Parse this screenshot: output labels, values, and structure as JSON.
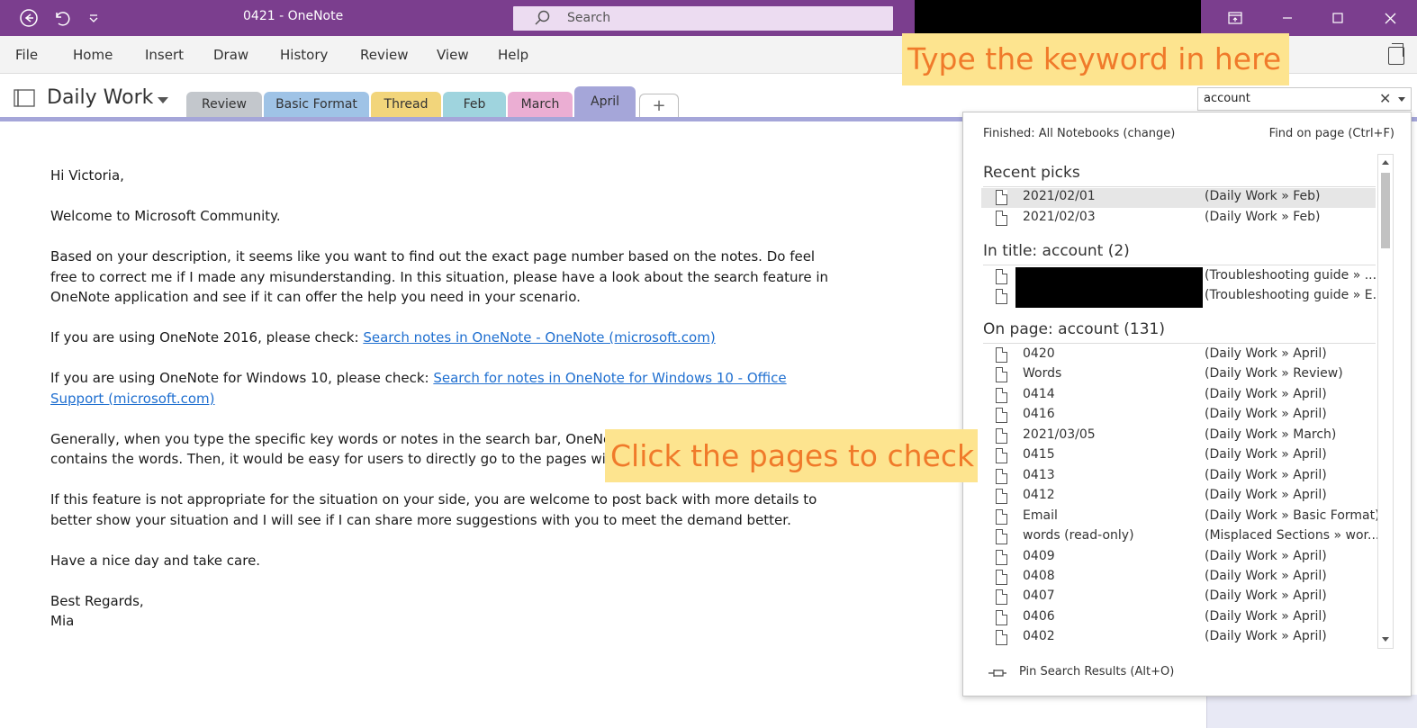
{
  "window": {
    "title": "0421  -  OneNote",
    "search_label": "Search"
  },
  "menu": [
    "File",
    "Home",
    "Insert",
    "Draw",
    "History",
    "Review",
    "View",
    "Help"
  ],
  "notebook": {
    "name": "Daily Work",
    "tabs": [
      {
        "label": "Review",
        "color": "#c3c7cc"
      },
      {
        "label": "Basic Format",
        "color": "#9fc3e6"
      },
      {
        "label": "Thread",
        "color": "#f2d57b"
      },
      {
        "label": "Feb",
        "color": "#9fd4de"
      },
      {
        "label": "March",
        "color": "#ebaed3"
      },
      {
        "label": "April",
        "color": "#a5a6d9",
        "active": true
      }
    ],
    "add_tab": "+"
  },
  "search": {
    "value": "account",
    "clear": "✕"
  },
  "page": {
    "greeting": "Hi Victoria,",
    "welcome": "Welcome to Microsoft Community.",
    "p1": "Based on your description, it seems like you want to find out the exact page number based on the notes. Do feel free to correct me if I made any misunderstanding. In this situation, please have a look about the search feature in OneNote application and see if it can offer the help you need in your scenario.",
    "p2_text": "If you are using OneNote 2016, please check: ",
    "p2_link": "Search notes in OneNote - OneNote (microsoft.com)",
    "p3_text": "If you are using OneNote for Windows 10, please check: ",
    "p3_link": "Search for notes in OneNote for Windows 10 - Office Support (microsoft.com)",
    "p4": "Generally, when you type the specific key words or notes in the search bar, OneNote will list the locations where contains the words. Then, it would be easy for users to directly go to the pages with the highlighted keywords.",
    "p5": "If this feature is not appropriate for the situation on your side, you are welcome to post back with more details to better show your situation and I will see if I can share more suggestions with you to meet the demand better.",
    "p6": "Have a nice day and take care.",
    "sign1": "Best Regards,",
    "sign2": "Mia"
  },
  "results": {
    "status": "Finished:  All Notebooks (change)",
    "find_on_page": "Find on page (Ctrl+F)",
    "recent_heading": "Recent picks",
    "recent": [
      {
        "name": "2021/02/01",
        "loc": "(Daily Work » Feb)"
      },
      {
        "name": "2021/02/03",
        "loc": "(Daily Work » Feb)"
      }
    ],
    "title_heading": "In title:  account (2)",
    "in_title": [
      {
        "name": "",
        "loc": "(Troubleshooting guide » ..."
      },
      {
        "name": "",
        "loc": "(Troubleshooting guide » E..."
      }
    ],
    "page_heading": "On page:  account (131)",
    "on_page": [
      {
        "name": "0420",
        "loc": "(Daily Work » April)"
      },
      {
        "name": "Words",
        "loc": "(Daily Work » Review)"
      },
      {
        "name": "0414",
        "loc": "(Daily Work » April)"
      },
      {
        "name": "0416",
        "loc": "(Daily Work » April)"
      },
      {
        "name": "2021/03/05",
        "loc": "(Daily Work » March)"
      },
      {
        "name": "0415",
        "loc": "(Daily Work » April)"
      },
      {
        "name": "0413",
        "loc": "(Daily Work » April)"
      },
      {
        "name": "0412",
        "loc": "(Daily Work » April)"
      },
      {
        "name": "Email",
        "loc": "(Daily Work » Basic Format)"
      },
      {
        "name": "words (read-only)",
        "loc": "(Misplaced Sections » wor..."
      },
      {
        "name": "0409",
        "loc": "(Daily Work » April)"
      },
      {
        "name": "0408",
        "loc": "(Daily Work » April)"
      },
      {
        "name": "0407",
        "loc": "(Daily Work » April)"
      },
      {
        "name": "0406",
        "loc": "(Daily Work » April)"
      },
      {
        "name": "0402",
        "loc": "(Daily Work » April)"
      }
    ],
    "pin": "Pin Search Results (Alt+O)"
  },
  "annotations": {
    "keyword": "Type the keyword in here",
    "pages": "Click the pages to check"
  },
  "colors": {
    "titlebar": "#7b3e8e",
    "link": "#1f6fd0",
    "callout_bg": "#fde48f",
    "callout_text": "#f07a2a"
  }
}
